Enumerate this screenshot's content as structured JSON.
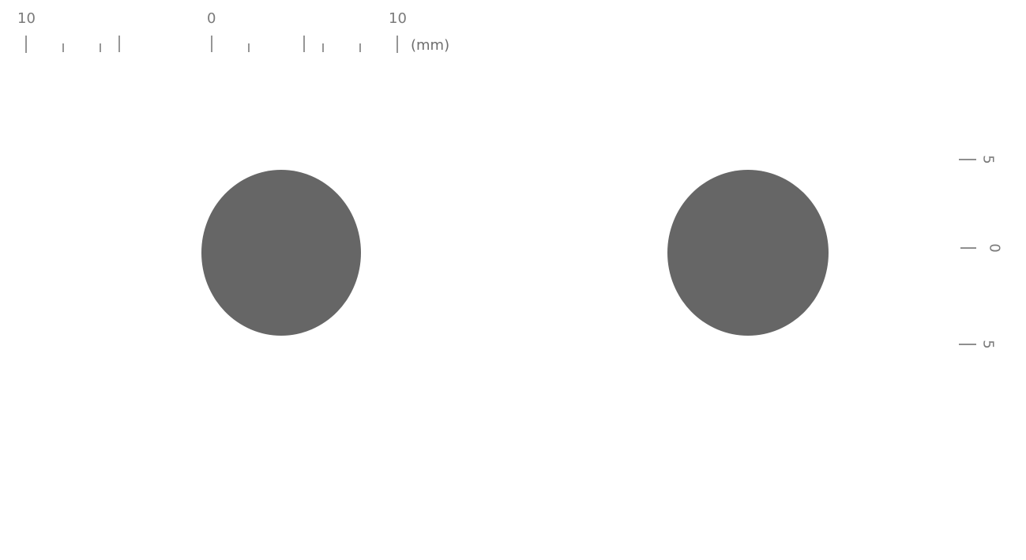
{
  "scale_bar": {
    "labels": [
      "10",
      "0",
      "10"
    ],
    "unit": "(mm)"
  },
  "vertical_scale": {
    "labels": [
      "5",
      "0",
      "5"
    ]
  },
  "colors": {
    "dot": "#666666",
    "tick": "#6a6a6a",
    "text": "#7a7a7a"
  }
}
